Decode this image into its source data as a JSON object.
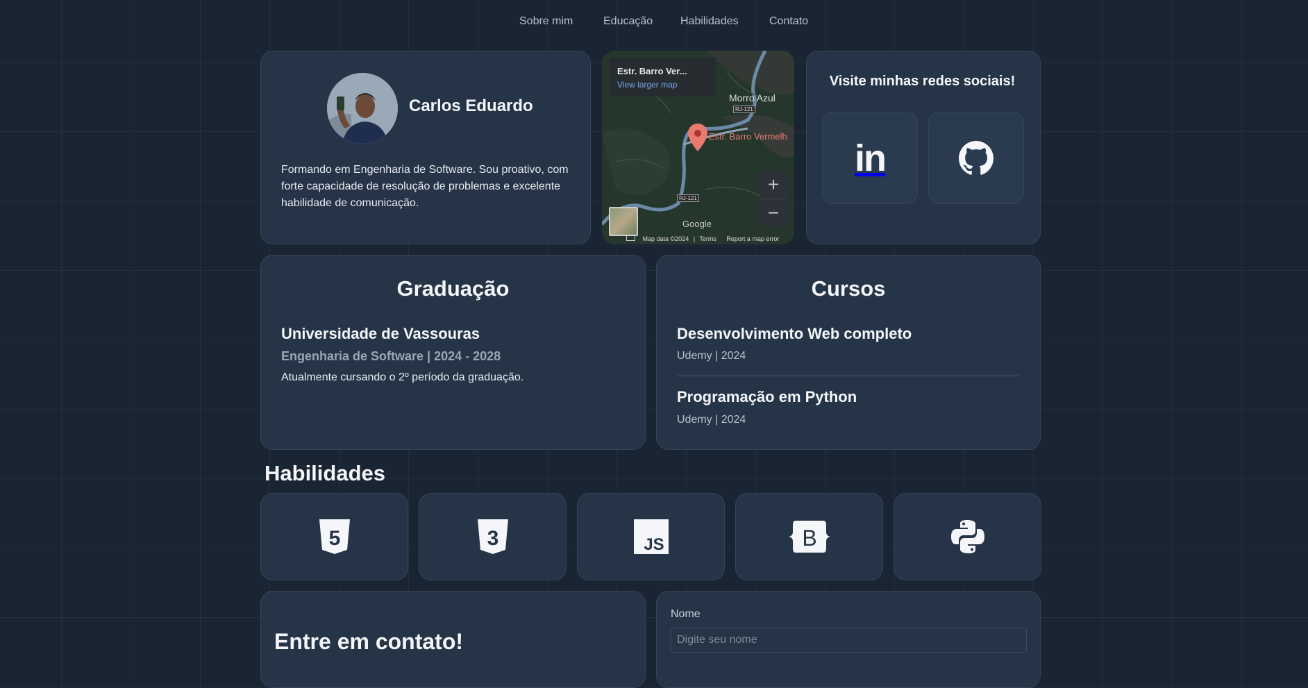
{
  "nav": {
    "items": [
      {
        "label": "Sobre mim"
      },
      {
        "label": "Educação"
      },
      {
        "label": "Habilidades"
      },
      {
        "label": "Contato"
      }
    ]
  },
  "profile": {
    "name": "Carlos Eduardo",
    "bio": "Formando em Engenharia de Software. Sou proativo, com forte capacidade de resolução de problemas e excelente habilidade de comunicação."
  },
  "map": {
    "place_title": "Estr. Barro Ver...",
    "larger_map_link": "View larger map",
    "place_label": "Estr. Barro Vermelh",
    "town_label": "Morro Azul",
    "road_label_1": "RJ-121",
    "road_label_2": "RJ-121",
    "zoom_in": "+",
    "zoom_out": "−",
    "google_logo": "Google",
    "map_data": "Map data ©2024",
    "terms": "Terms",
    "report": "Report a map error"
  },
  "social": {
    "title": "Visite minhas redes sociais!",
    "links": [
      {
        "icon": "linkedin-icon",
        "glyph": "in"
      },
      {
        "icon": "github-icon"
      }
    ]
  },
  "education": {
    "graduacao": {
      "title": "Graduação",
      "institution": "Universidade de Vassouras",
      "course": "Engenharia de Software | 2024 - 2028",
      "status": "Atualmente cursando o 2º período da graduação."
    },
    "cursos": {
      "title": "Cursos",
      "items": [
        {
          "name": "Desenvolvimento Web completo",
          "meta": "Udemy | 2024"
        },
        {
          "name": "Programação em Python",
          "meta": "Udemy | 2024"
        }
      ]
    }
  },
  "skills": {
    "title": "Habilidades",
    "items": [
      {
        "icon": "html5-icon",
        "glyph": "5"
      },
      {
        "icon": "css3-icon",
        "glyph": "3"
      },
      {
        "icon": "javascript-icon",
        "glyph": "JS"
      },
      {
        "icon": "bootstrap-icon",
        "glyph": "B"
      },
      {
        "icon": "python-icon"
      }
    ]
  },
  "contact": {
    "title": "Entre em contato!",
    "name_label": "Nome",
    "name_placeholder": "Digite seu nome"
  },
  "colors": {
    "background": "#1a2533",
    "card": "#253446",
    "card_border": "#34455a",
    "text": "#e8ecf2",
    "muted": "#9aa6b3",
    "map_pin": "#ea7a6f",
    "map_link": "#7aa7ea"
  }
}
